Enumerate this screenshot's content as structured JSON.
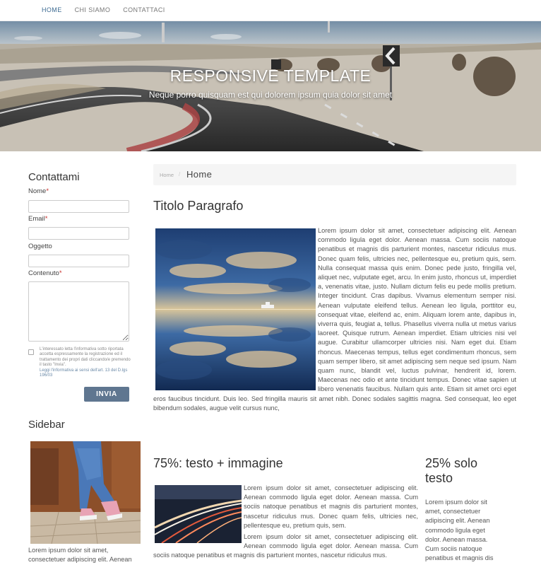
{
  "nav": {
    "items": [
      {
        "label": "HOME",
        "active": true
      },
      {
        "label": "CHI SIAMO",
        "active": false
      },
      {
        "label": "CONTATTACI",
        "active": false
      }
    ]
  },
  "hero": {
    "title": "RESPONSIVE TEMPLATE",
    "subtitle": "Neque porro quisquam est qui dolorem ipsum quia dolor sit amet"
  },
  "contact_form": {
    "title": "Contattami",
    "fields": {
      "nome": {
        "label": "Nome",
        "required": "*",
        "value": ""
      },
      "email": {
        "label": "Email",
        "required": "*",
        "value": ""
      },
      "oggetto": {
        "label": "Oggetto",
        "value": ""
      },
      "contenuto": {
        "label": "Contenuto",
        "required": "*",
        "value": ""
      }
    },
    "privacy_text": "L'interessato letta l'informativa sotto riportata accetta espressamente la registrazione ed il trattamento dei propri dati cliccando/e premendo il tasto \"Invia\".",
    "privacy_link": "Leggi l'informativa ai sensi dell'art. 13 del D.lgs 196/03",
    "submit_label": "INVIA"
  },
  "sidebar": {
    "title": "Sidebar",
    "text": "Lorem ipsum dolor sit amet, consectetuer adipiscing elit. Aenean"
  },
  "breadcrumb": {
    "home": "Home",
    "separator": "/",
    "current": "Home"
  },
  "main": {
    "title": "Titolo Paragrafo",
    "paragraph": "Lorem ipsum dolor sit amet, consectetuer adipiscing elit. Aenean commodo ligula eget dolor. Aenean massa. Cum sociis natoque penatibus et magnis dis parturient montes, nascetur ridiculus mus. Donec quam felis, ultricies nec, pellentesque eu, pretium quis, sem. Nulla consequat massa quis enim. Donec pede justo, fringilla vel, aliquet nec, vulputate eget, arcu. In enim justo, rhoncus ut, imperdiet a, venenatis vitae, justo. Nullam dictum felis eu pede mollis pretium. Integer tincidunt. Cras dapibus. Vivamus elementum semper nisi. Aenean vulputate eleifend tellus. Aenean leo ligula, porttitor eu, consequat vitae, eleifend ac, enim. Aliquam lorem ante, dapibus in, viverra quis, feugiat a, tellus. Phasellus viverra nulla ut metus varius laoreet. Quisque rutrum. Aenean imperdiet. Etiam ultricies nisi vel augue. Curabitur ullamcorper ultricies nisi. Nam eget dui. Etiam rhoncus. Maecenas tempus, tellus eget condimentum rhoncus, sem quam semper libero, sit amet adipiscing sem neque sed ipsum. Nam quam nunc, blandit vel, luctus pulvinar, hendrerit id, lorem. Maecenas nec odio et ante tincidunt tempus. Donec vitae sapien ut libero venenatis faucibus. Nullam quis ante. Etiam sit amet orci eget eros faucibus tincidunt. Duis leo. Sed fringilla mauris sit amet nibh. Donec sodales sagittis magna. Sed consequat, leo eget bibendum sodales, augue velit cursus nunc,"
  },
  "section75": {
    "title": "75%: testo + immagine",
    "paragraph1": "Lorem ipsum dolor sit amet, consectetuer adipiscing elit. Aenean commodo ligula eget dolor. Aenean massa. Cum sociis natoque penatibus et magnis dis parturient montes, nascetur ridiculus mus. Donec quam felis, ultricies nec, pellentesque eu, pretium quis, sem.",
    "paragraph2": "Lorem ipsum dolor sit amet, consectetuer adipiscing elit. Aenean commodo ligula eget dolor. Aenean massa. Cum sociis natoque penatibus et magnis dis parturient montes, nascetur ridiculus mus."
  },
  "section25": {
    "title": "25% solo testo",
    "paragraph": "Lorem ipsum dolor sit amet, consectetuer adipiscing elit. Aenean commodo ligula eget dolor. Aenean massa. Cum sociis natoque penatibus et magnis dis"
  },
  "colors": {
    "nav_active": "#3d6b92",
    "button": "#5f7690",
    "required": "#c9302c",
    "breadcrumb_bg": "#f5f5f5"
  }
}
